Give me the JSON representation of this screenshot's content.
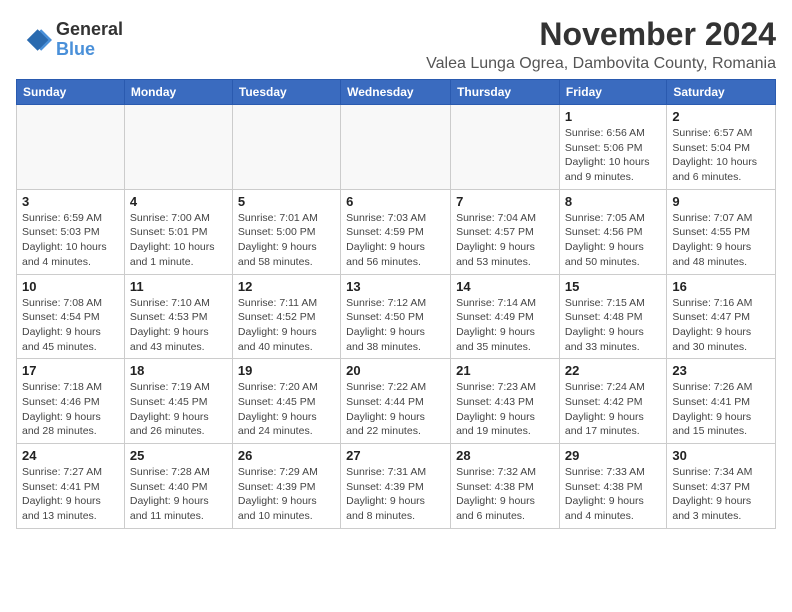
{
  "header": {
    "logo_line1": "General",
    "logo_line2": "Blue",
    "month_year": "November 2024",
    "location": "Valea Lunga Ogrea, Dambovita County, Romania"
  },
  "weekdays": [
    "Sunday",
    "Monday",
    "Tuesday",
    "Wednesday",
    "Thursday",
    "Friday",
    "Saturday"
  ],
  "weeks": [
    [
      {
        "day": "",
        "info": ""
      },
      {
        "day": "",
        "info": ""
      },
      {
        "day": "",
        "info": ""
      },
      {
        "day": "",
        "info": ""
      },
      {
        "day": "",
        "info": ""
      },
      {
        "day": "1",
        "info": "Sunrise: 6:56 AM\nSunset: 5:06 PM\nDaylight: 10 hours\nand 9 minutes."
      },
      {
        "day": "2",
        "info": "Sunrise: 6:57 AM\nSunset: 5:04 PM\nDaylight: 10 hours\nand 6 minutes."
      }
    ],
    [
      {
        "day": "3",
        "info": "Sunrise: 6:59 AM\nSunset: 5:03 PM\nDaylight: 10 hours\nand 4 minutes."
      },
      {
        "day": "4",
        "info": "Sunrise: 7:00 AM\nSunset: 5:01 PM\nDaylight: 10 hours\nand 1 minute."
      },
      {
        "day": "5",
        "info": "Sunrise: 7:01 AM\nSunset: 5:00 PM\nDaylight: 9 hours\nand 58 minutes."
      },
      {
        "day": "6",
        "info": "Sunrise: 7:03 AM\nSunset: 4:59 PM\nDaylight: 9 hours\nand 56 minutes."
      },
      {
        "day": "7",
        "info": "Sunrise: 7:04 AM\nSunset: 4:57 PM\nDaylight: 9 hours\nand 53 minutes."
      },
      {
        "day": "8",
        "info": "Sunrise: 7:05 AM\nSunset: 4:56 PM\nDaylight: 9 hours\nand 50 minutes."
      },
      {
        "day": "9",
        "info": "Sunrise: 7:07 AM\nSunset: 4:55 PM\nDaylight: 9 hours\nand 48 minutes."
      }
    ],
    [
      {
        "day": "10",
        "info": "Sunrise: 7:08 AM\nSunset: 4:54 PM\nDaylight: 9 hours\nand 45 minutes."
      },
      {
        "day": "11",
        "info": "Sunrise: 7:10 AM\nSunset: 4:53 PM\nDaylight: 9 hours\nand 43 minutes."
      },
      {
        "day": "12",
        "info": "Sunrise: 7:11 AM\nSunset: 4:52 PM\nDaylight: 9 hours\nand 40 minutes."
      },
      {
        "day": "13",
        "info": "Sunrise: 7:12 AM\nSunset: 4:50 PM\nDaylight: 9 hours\nand 38 minutes."
      },
      {
        "day": "14",
        "info": "Sunrise: 7:14 AM\nSunset: 4:49 PM\nDaylight: 9 hours\nand 35 minutes."
      },
      {
        "day": "15",
        "info": "Sunrise: 7:15 AM\nSunset: 4:48 PM\nDaylight: 9 hours\nand 33 minutes."
      },
      {
        "day": "16",
        "info": "Sunrise: 7:16 AM\nSunset: 4:47 PM\nDaylight: 9 hours\nand 30 minutes."
      }
    ],
    [
      {
        "day": "17",
        "info": "Sunrise: 7:18 AM\nSunset: 4:46 PM\nDaylight: 9 hours\nand 28 minutes."
      },
      {
        "day": "18",
        "info": "Sunrise: 7:19 AM\nSunset: 4:45 PM\nDaylight: 9 hours\nand 26 minutes."
      },
      {
        "day": "19",
        "info": "Sunrise: 7:20 AM\nSunset: 4:45 PM\nDaylight: 9 hours\nand 24 minutes."
      },
      {
        "day": "20",
        "info": "Sunrise: 7:22 AM\nSunset: 4:44 PM\nDaylight: 9 hours\nand 22 minutes."
      },
      {
        "day": "21",
        "info": "Sunrise: 7:23 AM\nSunset: 4:43 PM\nDaylight: 9 hours\nand 19 minutes."
      },
      {
        "day": "22",
        "info": "Sunrise: 7:24 AM\nSunset: 4:42 PM\nDaylight: 9 hours\nand 17 minutes."
      },
      {
        "day": "23",
        "info": "Sunrise: 7:26 AM\nSunset: 4:41 PM\nDaylight: 9 hours\nand 15 minutes."
      }
    ],
    [
      {
        "day": "24",
        "info": "Sunrise: 7:27 AM\nSunset: 4:41 PM\nDaylight: 9 hours\nand 13 minutes."
      },
      {
        "day": "25",
        "info": "Sunrise: 7:28 AM\nSunset: 4:40 PM\nDaylight: 9 hours\nand 11 minutes."
      },
      {
        "day": "26",
        "info": "Sunrise: 7:29 AM\nSunset: 4:39 PM\nDaylight: 9 hours\nand 10 minutes."
      },
      {
        "day": "27",
        "info": "Sunrise: 7:31 AM\nSunset: 4:39 PM\nDaylight: 9 hours\nand 8 minutes."
      },
      {
        "day": "28",
        "info": "Sunrise: 7:32 AM\nSunset: 4:38 PM\nDaylight: 9 hours\nand 6 minutes."
      },
      {
        "day": "29",
        "info": "Sunrise: 7:33 AM\nSunset: 4:38 PM\nDaylight: 9 hours\nand 4 minutes."
      },
      {
        "day": "30",
        "info": "Sunrise: 7:34 AM\nSunset: 4:37 PM\nDaylight: 9 hours\nand 3 minutes."
      }
    ]
  ]
}
